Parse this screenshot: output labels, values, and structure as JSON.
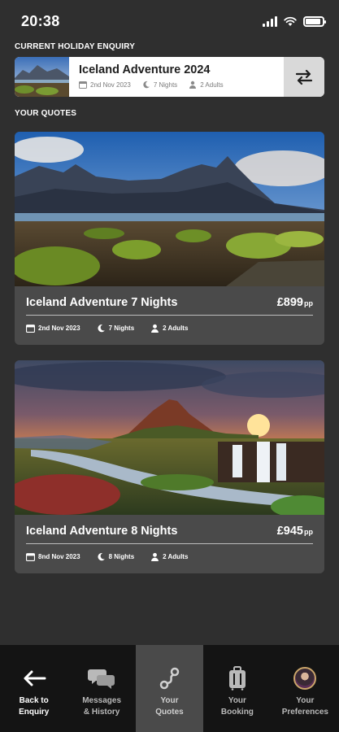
{
  "status_bar": {
    "time": "20:38"
  },
  "enquiry_section": {
    "label": "CURRENT HOLIDAY ENQUIRY",
    "title": "Iceland Adventure 2024",
    "date": "2nd Nov 2023",
    "nights": "7 Nights",
    "travellers": "2 Adults"
  },
  "quotes_section": {
    "label": "YOUR QUOTES",
    "quotes": [
      {
        "title": "Iceland Adventure 7 Nights",
        "price": "£899",
        "price_suffix": "pp",
        "date": "2nd Nov 2023",
        "nights": "7 Nights",
        "travellers": "2 Adults"
      },
      {
        "title": "Iceland Adventure 8 Nights",
        "price": "£945",
        "price_suffix": "pp",
        "date": "8nd Nov 2023",
        "nights": "8 Nights",
        "travellers": "2 Adults"
      }
    ]
  },
  "bottom_nav": {
    "items": [
      {
        "label": "Back to\nEnquiry",
        "icon": "arrow-left-icon"
      },
      {
        "label": "Messages\n& History",
        "icon": "chat-bubbles-icon"
      },
      {
        "label": "Your\nQuotes",
        "icon": "route-icon",
        "active": true
      },
      {
        "label": "Your\nBooking",
        "icon": "suitcase-icon"
      },
      {
        "label": "Your\nPreferences",
        "icon": "avatar"
      }
    ]
  },
  "colors": {
    "background": "#2f2f2f",
    "card": "#4a4a4a",
    "nav": "#141414",
    "active_nav": "#4a4a4a"
  }
}
